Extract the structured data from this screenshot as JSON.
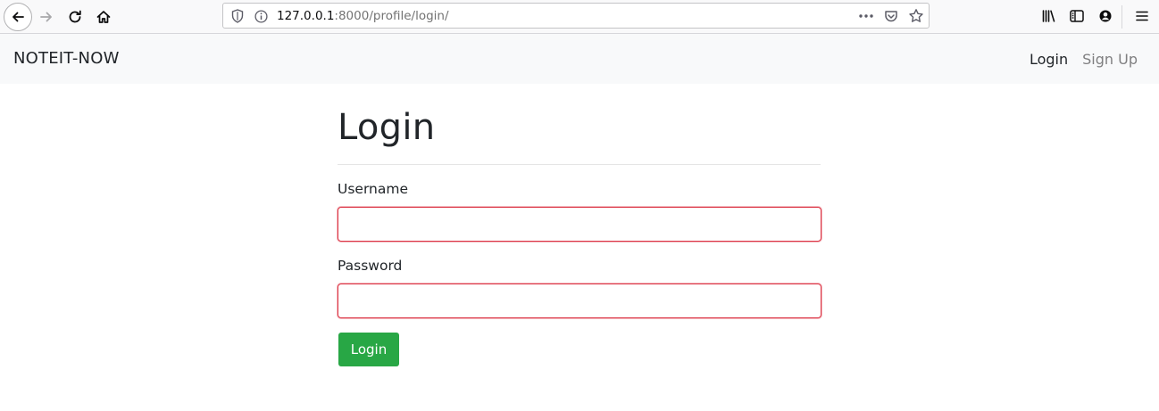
{
  "browser": {
    "url_host": "127.0.0.1",
    "url_rest": ":8000/profile/login/",
    "icons": [
      "back-arrow-icon",
      "forward-arrow-icon",
      "reload-icon",
      "home-icon",
      "shield-icon",
      "info-icon",
      "page-actions-icon",
      "pocket-icon",
      "bookmark-star-icon",
      "library-icon",
      "sidebar-icon",
      "account-icon",
      "hamburger-menu-icon"
    ]
  },
  "navbar": {
    "brand": "NOTEIT-NOW",
    "links": [
      {
        "label": "Login"
      },
      {
        "label": "Sign Up"
      }
    ]
  },
  "form": {
    "title": "Login",
    "username_label": "Username",
    "username_value": "",
    "password_label": "Password",
    "password_value": "",
    "submit_label": "Login"
  },
  "colors": {
    "navbar_bg": "#f8f9fa",
    "invalid_border": "#dc3545",
    "button_success": "#28a745"
  }
}
